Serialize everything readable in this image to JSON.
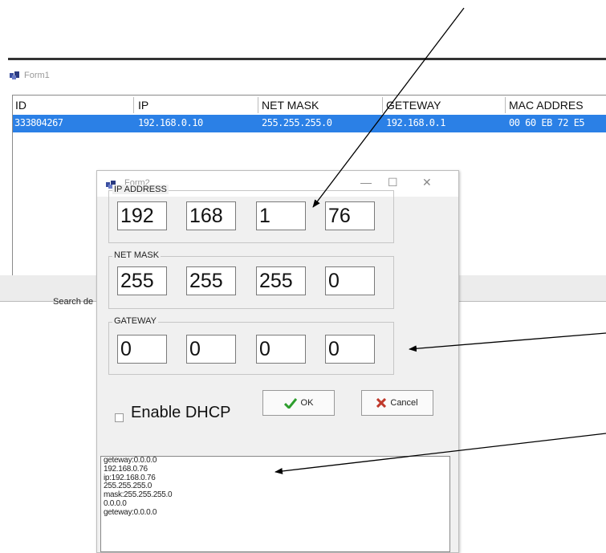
{
  "form1": {
    "title": "Form1",
    "columns": [
      "ID",
      "IP",
      "NET MASK",
      "GETEWAY",
      "MAC ADDRES"
    ],
    "selected_row": [
      "333804267",
      "192.168.0.10",
      "255.255.255.0",
      "192.168.0.1",
      "00 60 EB 72 E5"
    ],
    "search_button": "Search de"
  },
  "form2": {
    "title": "Form2",
    "window_controls": {
      "minimize": "—",
      "maximize": "☐",
      "close": "✕"
    },
    "ip_address": {
      "label": "IP ADDRESS",
      "octets": [
        "192",
        "168",
        "1",
        "76"
      ]
    },
    "net_mask": {
      "label": "NET MASK",
      "octets": [
        "255",
        "255",
        "255",
        "0"
      ]
    },
    "gateway": {
      "label": "GATEWAY",
      "octets": [
        "0",
        "0",
        "0",
        "0"
      ]
    },
    "dhcp_label": "Enable DHCP",
    "ok_label": "OK",
    "cancel_label": "Cancel",
    "log_lines": [
      "geteway:0.0.0.0",
      "192.168.0.76",
      "ip:192.168.0.76",
      "255.255.255.0",
      "mask:255.255.255.0",
      "0.0.0.0",
      "geteway:0.0.0.0"
    ]
  },
  "colors": {
    "selection": "#2b80e6",
    "ok_check": "#2e9e2e",
    "cancel_x": "#c0392b"
  },
  "icons": [
    "app-icon",
    "minimize-icon",
    "maximize-icon",
    "close-icon",
    "checkmark-icon",
    "cancel-x-icon",
    "arrow-icon"
  ]
}
